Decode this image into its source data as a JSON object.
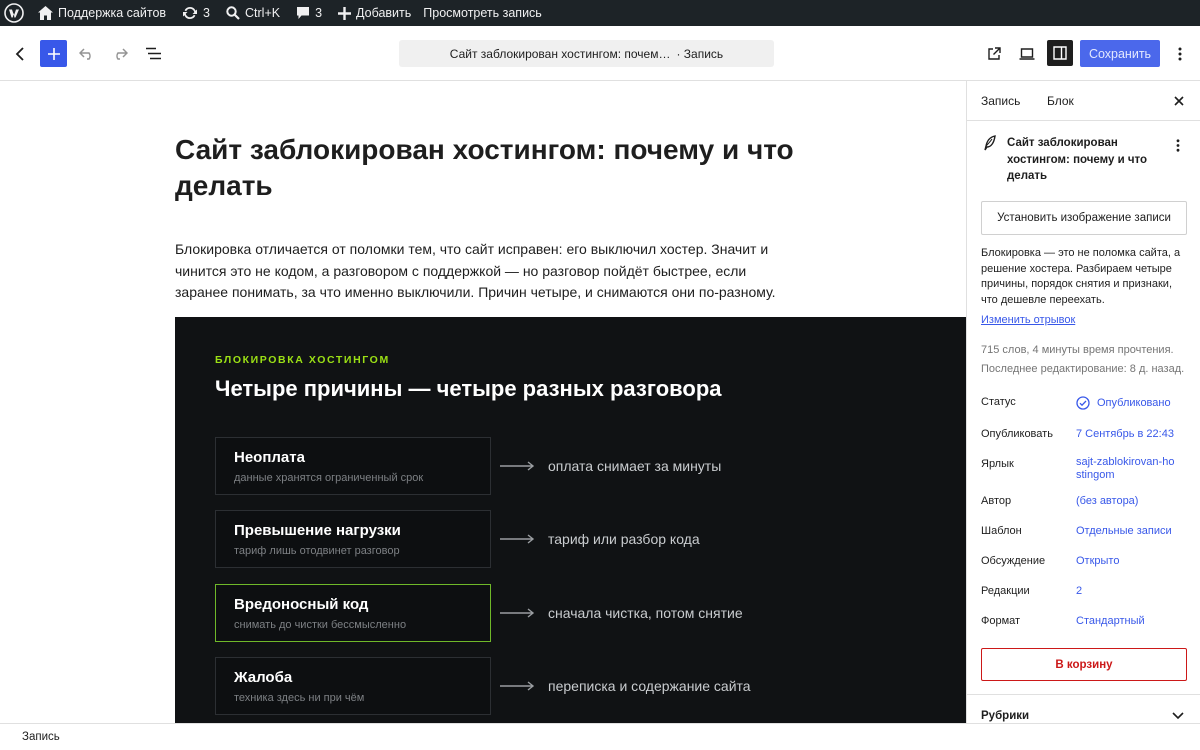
{
  "admin_bar": {
    "site_name": "Поддержка сайтов",
    "updates_count": "3",
    "search_shortcut": "Ctrl+K",
    "comments_count": "3",
    "add_label": "Добавить",
    "view_label": "Просмотреть запись"
  },
  "header": {
    "doc_title": "Сайт заблокирован хостингом: почем…",
    "doc_type": "· Запись",
    "save_label": "Сохранить"
  },
  "post": {
    "title": "Сайт заблокирован хостингом: почему и что делать",
    "paragraph": "Блокировка отличается от поломки тем, что сайт исправен: его выключил хостер. Значит и чинится это не кодом, а разговором с поддержкой — но разговор пойдёт быстрее, если заранее понимать, за что именно выключили. Причин четыре, и снимаются они по-разному.",
    "block": {
      "eyebrow": "БЛОКИРОВКА ХОСТИНГОМ",
      "heading": "Четыре причины — четыре разных разговора",
      "reasons": [
        {
          "title": "Неоплата",
          "subtitle": "данные хранятся ограниченный срок",
          "result": "оплата снимает за минуты",
          "highlight": false
        },
        {
          "title": "Превышение нагрузки",
          "subtitle": "тариф лишь отодвинет разговор",
          "result": "тариф или разбор кода",
          "highlight": false
        },
        {
          "title": "Вредоносный код",
          "subtitle": "снимать до чистки бессмысленно",
          "result": "сначала чистка, потом снятие",
          "highlight": true
        },
        {
          "title": "Жалоба",
          "subtitle": "техника здесь ни при чём",
          "result": "переписка и содержание сайта",
          "highlight": false
        }
      ]
    }
  },
  "sidebar": {
    "tab_post": "Запись",
    "tab_block": "Блок",
    "title": "Сайт заблокирован хостингом: почему и что делать",
    "featured_image_label": "Установить изображение записи",
    "excerpt": "Блокировка — это не поломка сайта, а решение хостера. Разбираем четыре причины, порядок снятия и признаки, что дешевле переехать.",
    "edit_excerpt_label": "Изменить отрывок",
    "stats": "715 слов, 4 минуты время прочтения.",
    "last_edited": "Последнее редактирование: 8 д. назад.",
    "rows": [
      {
        "label": "Статус",
        "value": "Опубликовано"
      },
      {
        "label": "Опубликовать",
        "value": "7 Сентябрь в 22:43"
      },
      {
        "label": "Ярлык",
        "value": "sajt-zablokirovan-hostingom"
      },
      {
        "label": "Автор",
        "value": "(без автора)"
      },
      {
        "label": "Шаблон",
        "value": "Отдельные записи"
      },
      {
        "label": "Обсуждение",
        "value": "Открыто"
      },
      {
        "label": "Редакции",
        "value": "2"
      },
      {
        "label": "Формат",
        "value": "Стандартный"
      }
    ],
    "trash_label": "В корзину",
    "categories_label": "Рубрики"
  },
  "footer": {
    "breadcrumb": "Запись"
  },
  "colors": {
    "accent": "#3858e9",
    "dark_block_bg": "#101214",
    "eyebrow": "#9be015",
    "highlight_border": "#6fb829",
    "danger": "#cc1818"
  }
}
